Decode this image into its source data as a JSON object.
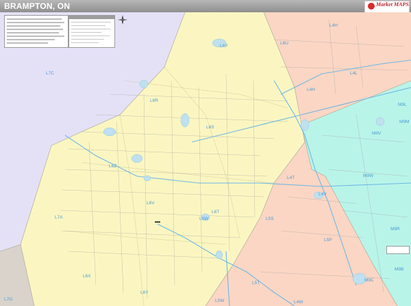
{
  "title": "BRAMPTON, ON",
  "brand": {
    "text": "Market MAPS"
  },
  "colors": {
    "yellow_zone": "#fbf6c1",
    "purple_zone": "#e4e1f7",
    "salmon_zone": "#fbd6c4",
    "cyan_zone": "#b9f4e9",
    "gray_zone": "#d9d3cc",
    "water": "#bfe0ee",
    "highway": "#6fb8e6",
    "road": "#9b9b9b",
    "label": "#4a9bd4",
    "title_bar": "#9a9a9a"
  },
  "zip_labels": [
    {
      "id": "l6p",
      "text": "L6P"
    },
    {
      "id": "l6u",
      "text": "L6U"
    },
    {
      "id": "l4h",
      "text": "L4H"
    },
    {
      "id": "l4l",
      "text": "L4L"
    },
    {
      "id": "l4h2",
      "text": "L4H"
    },
    {
      "id": "l7c",
      "text": "L7C"
    },
    {
      "id": "l6r",
      "text": "L6R"
    },
    {
      "id": "l6s",
      "text": "L6S"
    },
    {
      "id": "m9l",
      "text": "M9L"
    },
    {
      "id": "m9m",
      "text": "M9M"
    },
    {
      "id": "m9v",
      "text": "M9V"
    },
    {
      "id": "m9w",
      "text": "M9W"
    },
    {
      "id": "l6z",
      "text": "L6Z"
    },
    {
      "id": "l4t",
      "text": "L4T"
    },
    {
      "id": "l4v",
      "text": "L4V"
    },
    {
      "id": "l6v",
      "text": "L6V"
    },
    {
      "id": "l6t",
      "text": "L6T"
    },
    {
      "id": "l6w",
      "text": "L6W"
    },
    {
      "id": "l7a",
      "text": "L7A"
    },
    {
      "id": "l5s",
      "text": "L5S"
    },
    {
      "id": "l5p",
      "text": "L5P"
    },
    {
      "id": "m9r",
      "text": "M9R"
    },
    {
      "id": "l6x",
      "text": "L6X"
    },
    {
      "id": "l6y",
      "text": "L6Y"
    },
    {
      "id": "l5t",
      "text": "L5T"
    },
    {
      "id": "l5w",
      "text": "L5W"
    },
    {
      "id": "m9c",
      "text": "M9C"
    },
    {
      "id": "m9b",
      "text": "M9B"
    },
    {
      "id": "l7g",
      "text": "L7G"
    },
    {
      "id": "l4w",
      "text": "L4W"
    }
  ]
}
